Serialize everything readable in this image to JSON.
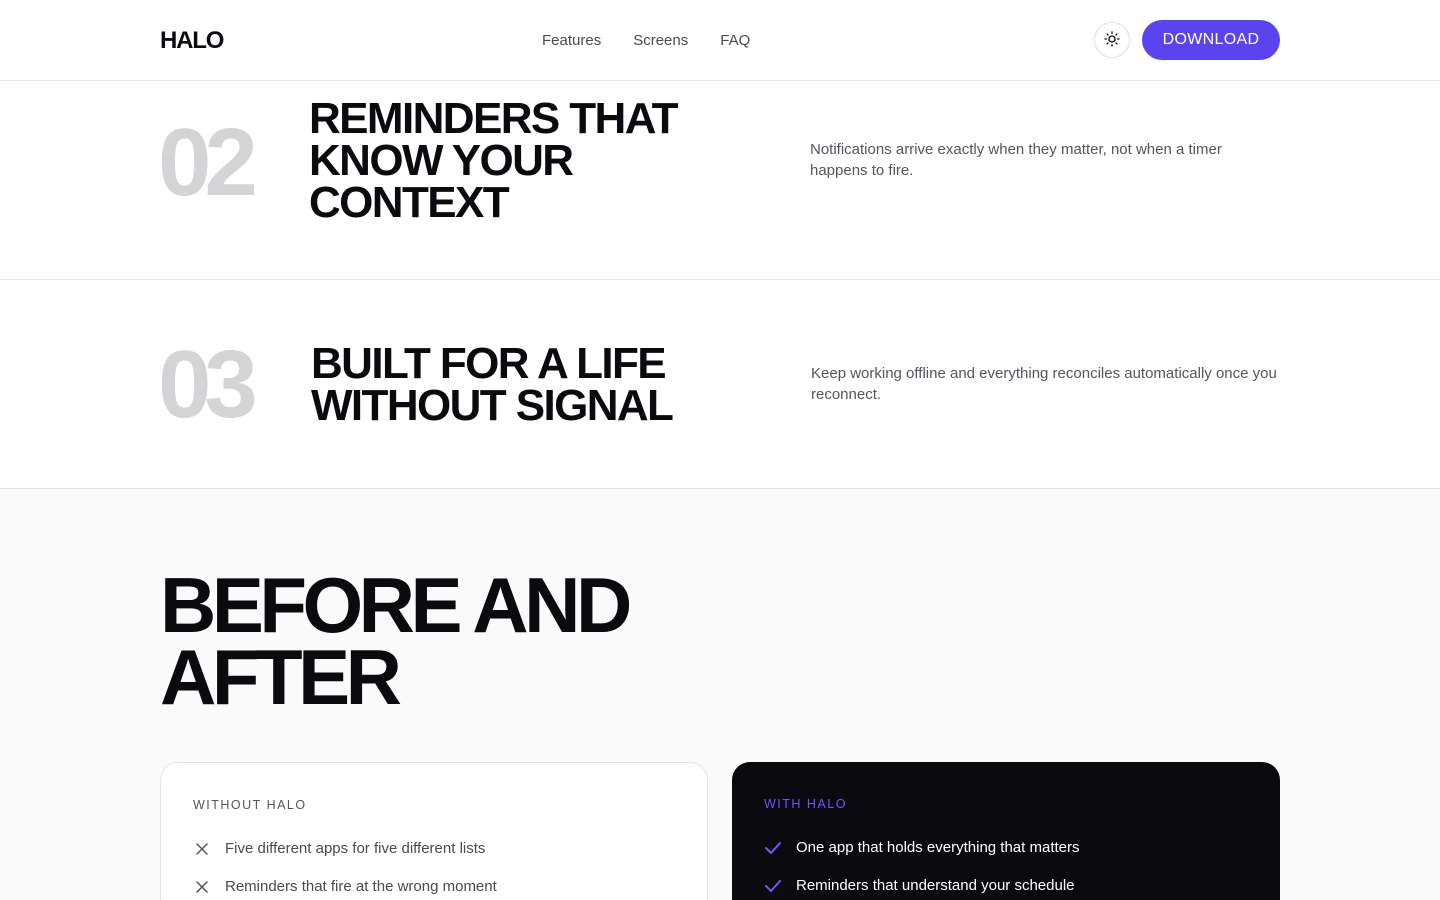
{
  "header": {
    "logo": "HALO",
    "nav": [
      "Features",
      "Screens",
      "FAQ"
    ],
    "theme_toggle_icon": "sun-icon",
    "download_label": "DOWNLOAD",
    "accent_color": "#5b43f0"
  },
  "features": [
    {
      "number": "02",
      "title": "REMINDERS THAT KNOW YOUR CONTEXT",
      "description": "Notifications arrive exactly when they matter, not when a timer happens to fire."
    },
    {
      "number": "03",
      "title": "BUILT FOR A LIFE WITHOUT SIGNAL",
      "description": "Keep working offline and everything reconciles automatically once you reconnect."
    }
  ],
  "before_after": {
    "title": "BEFORE AND AFTER",
    "without": {
      "label": "WITHOUT HALO",
      "icon": "x-icon",
      "items": [
        "Five different apps for five different lists",
        "Reminders that fire at the wrong moment"
      ]
    },
    "with": {
      "label": "WITH HALO",
      "icon": "check-icon",
      "check_color": "#6d57ff",
      "items": [
        "One app that holds everything that matters",
        "Reminders that understand your schedule"
      ]
    }
  }
}
